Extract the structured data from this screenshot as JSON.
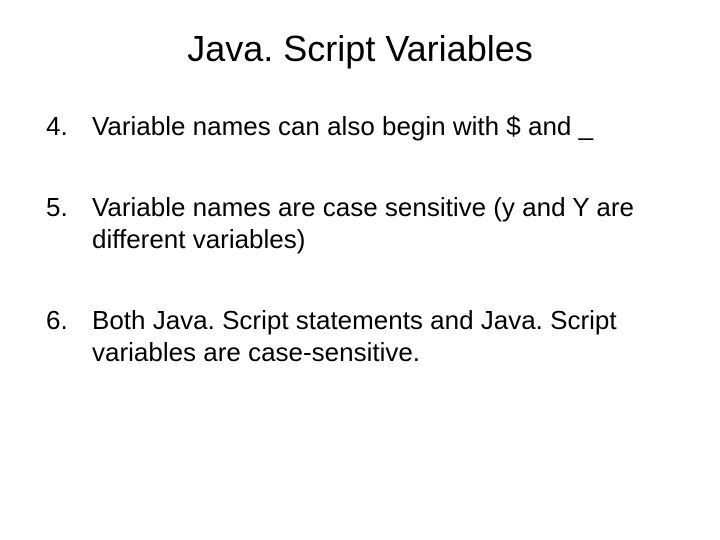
{
  "title": "Java. Script Variables",
  "list": {
    "start": 4,
    "items": [
      {
        "n": "4.",
        "text": "Variable names can also begin with $ and _"
      },
      {
        "n": "5.",
        "text": "Variable names are case sensitive (y and Y are different variables)"
      },
      {
        "n": "6.",
        "text": "Both Java. Script statements and Java. Script variables are case-sensitive."
      }
    ]
  }
}
